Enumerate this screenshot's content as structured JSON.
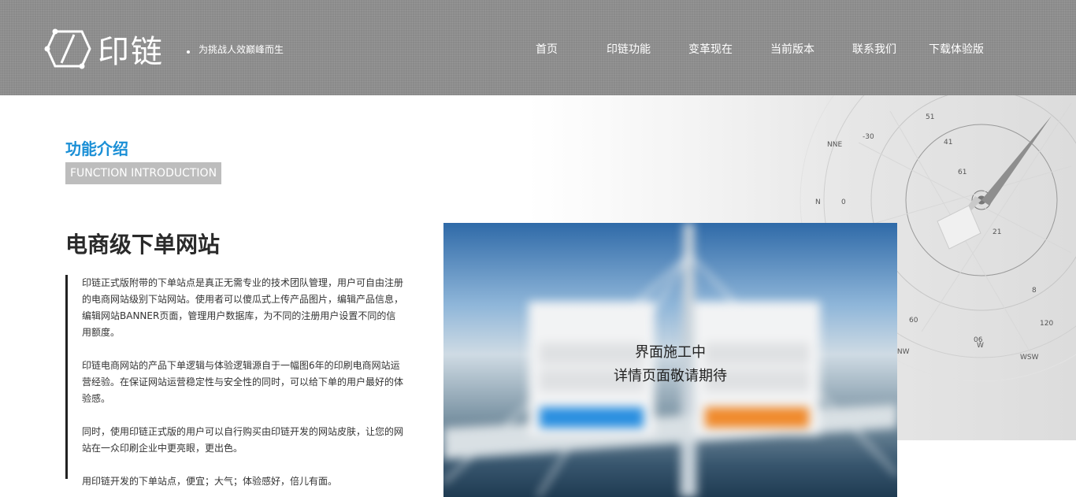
{
  "header": {
    "logo_text": "印链",
    "slogan": "为挑战人效巅峰而生",
    "nav": [
      "首页",
      "印链功能",
      "变革现在",
      "当前版本",
      "联系我们",
      "下载体验版"
    ]
  },
  "section": {
    "title": "功能介绍",
    "subtitle": "FUNCTION INTRODUCTION"
  },
  "feature": {
    "title": "电商级下单网站",
    "paragraphs": [
      "印链正式版附带的下单站点是真正无需专业的技术团队管理，用户可自由注册的电商网站级别下站网站。使用者可以傻瓜式上传产品图片，编辑产品信息，编辑网站BANNER页面，管理用户数据库，为不同的注册用户设置不同的信用额度。",
      "印链电商网站的产品下单逻辑与体验逻辑源自于一幅图6年的印刷电商网站运营经验。在保证网站运营稳定性与安全性的同时，可以给下单的用户最好的体验感。",
      "同时，使用印链正式版的用户可以自行购买由印链开发的网站皮肤，让您的网站在一众印刷企业中更亮眼，更出色。",
      "用印链开发的下单站点，便宜；大气；体验感好，倍儿有面。"
    ]
  },
  "preview": {
    "line1": "界面施工中",
    "line2": "详情页面敬请期待"
  },
  "compass": {
    "labels": [
      "NNE",
      "WNW",
      "NW",
      "WSW",
      "W",
      "N",
      "51",
      "41",
      "61",
      "21",
      "60",
      "06",
      "120",
      "-30",
      "8",
      "0"
    ]
  },
  "colors": {
    "header_bg": "#8a8a8a",
    "accent": "#1a8fd6",
    "subtitle_bg": "#bdbdbd"
  }
}
